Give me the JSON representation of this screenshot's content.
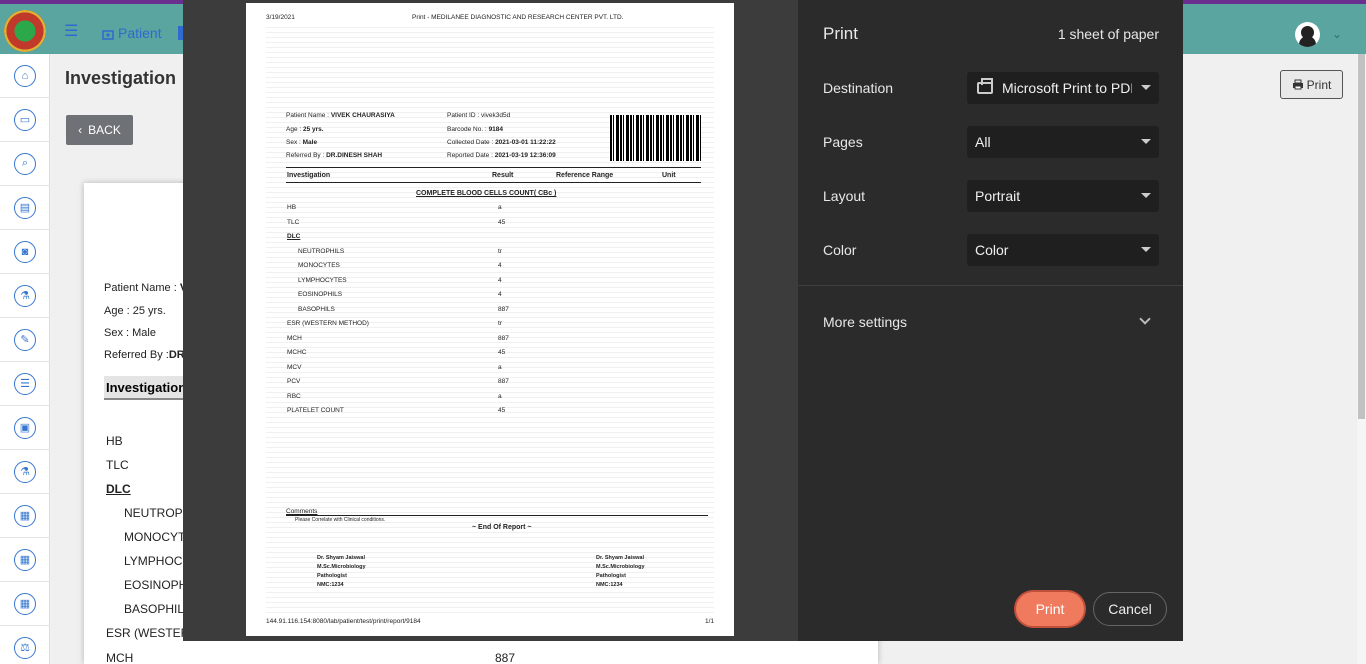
{
  "app": {
    "nav_patient": "Patient",
    "page_title": "Investigation",
    "back_label": "BACK",
    "print_label": "Print"
  },
  "sidebar": {
    "icons": [
      "home-icon",
      "bed-icon",
      "search-icon",
      "book-icon",
      "camera-icon",
      "flask-icon",
      "edit-icon",
      "list-icon",
      "image-icon",
      "lab-icon",
      "grid-icon",
      "grid-icon",
      "grid-icon",
      "scale-icon"
    ]
  },
  "background_report": {
    "patient_name_label": "Patient Name :",
    "patient_name_initial": "V",
    "age": "Age : 25 yrs.",
    "sex": "Sex : Male",
    "referred_label": "Referred By :",
    "referred_initial": "DR.",
    "investigation_header": "Investigation",
    "rows": [
      "HB",
      "TLC",
      "DLC",
      "NEUTROP",
      "MONOCYT",
      "LYMPHOCY",
      "EOSINOPH",
      "BASOPHIL",
      "ESR (WESTER",
      "MCH"
    ],
    "mch_value": "887"
  },
  "print_dialog": {
    "title": "Print",
    "sheet_count": "1 sheet of paper",
    "destination_label": "Destination",
    "destination_value": "Microsoft Print to PDF",
    "pages_label": "Pages",
    "pages_value": "All",
    "layout_label": "Layout",
    "layout_value": "Portrait",
    "color_label": "Color",
    "color_value": "Color",
    "more_settings": "More settings",
    "print_button": "Print",
    "cancel_button": "Cancel"
  },
  "preview": {
    "date": "3/19/2021",
    "header_title": "Print - MEDILANEE DIAGNOSTIC AND RESEARCH CENTER PVT. LTD.",
    "patient_name_label": "Patient Name :",
    "patient_name": "VIVEK CHAURASIYA",
    "patient_id_label": "Patient ID :",
    "patient_id": "vivek3d5d",
    "age_label": "Age :",
    "age": "25 yrs.",
    "barcode_label": "Barcode No. :",
    "barcode": "9184",
    "sex_label": "Sex :",
    "sex": "Male",
    "collected_label": "Collected Date :",
    "collected": "2021-03-01 11:22:22",
    "referred_label": "Referred By :",
    "referred": "DR.DINESH SHAH",
    "reported_label": "Reported Date :",
    "reported": "2021-03-19 12:36:09",
    "col_investigation": "Investigation",
    "col_result": "Result",
    "col_reference": "Reference Range",
    "col_unit": "Unit",
    "test_title": "COMPLETE BLOOD CELLS COUNT( CBc )",
    "rows": [
      {
        "name": "HB",
        "result": "a",
        "indent": false,
        "bold": false
      },
      {
        "name": "TLC",
        "result": "45",
        "indent": false,
        "bold": false
      },
      {
        "name": "DLC",
        "result": "",
        "indent": false,
        "bold": true
      },
      {
        "name": "NEUTROPHILS",
        "result": "tr",
        "indent": true,
        "bold": false
      },
      {
        "name": "MONOCYTES",
        "result": "4",
        "indent": true,
        "bold": false
      },
      {
        "name": "LYMPHOCYTES",
        "result": "4",
        "indent": true,
        "bold": false
      },
      {
        "name": "EOSINOPHILS",
        "result": "4",
        "indent": true,
        "bold": false
      },
      {
        "name": "BASOPHILS",
        "result": "887",
        "indent": true,
        "bold": false
      },
      {
        "name": "ESR (WESTERN METHOD)",
        "result": "tr",
        "indent": false,
        "bold": false
      },
      {
        "name": "MCH",
        "result": "887",
        "indent": false,
        "bold": false
      },
      {
        "name": "MCHC",
        "result": "45",
        "indent": false,
        "bold": false
      },
      {
        "name": "MCV",
        "result": "a",
        "indent": false,
        "bold": false
      },
      {
        "name": "PCV",
        "result": "887",
        "indent": false,
        "bold": false
      },
      {
        "name": "RBC",
        "result": "a",
        "indent": false,
        "bold": false
      },
      {
        "name": "PLATELET COUNT",
        "result": "45",
        "indent": false,
        "bold": false
      }
    ],
    "comments_label": "Comments",
    "comments_text": "Please Correlate with Clinical conditions.",
    "end_of_report": "~ End Of Report ~",
    "signer_left": [
      "Dr. Shyam Jaiswal",
      "M.Sc.Microbiology",
      "Pathologist",
      "NMC:1234"
    ],
    "signer_right": [
      "Dr. Shyam Jaiswal",
      "M.Sc.Microbiology",
      "Pathologist",
      "NMC:1234"
    ],
    "footer_url": "144.91.116.154:8080/lab/patient/test/print/report/9184",
    "page_number": "1/1"
  }
}
